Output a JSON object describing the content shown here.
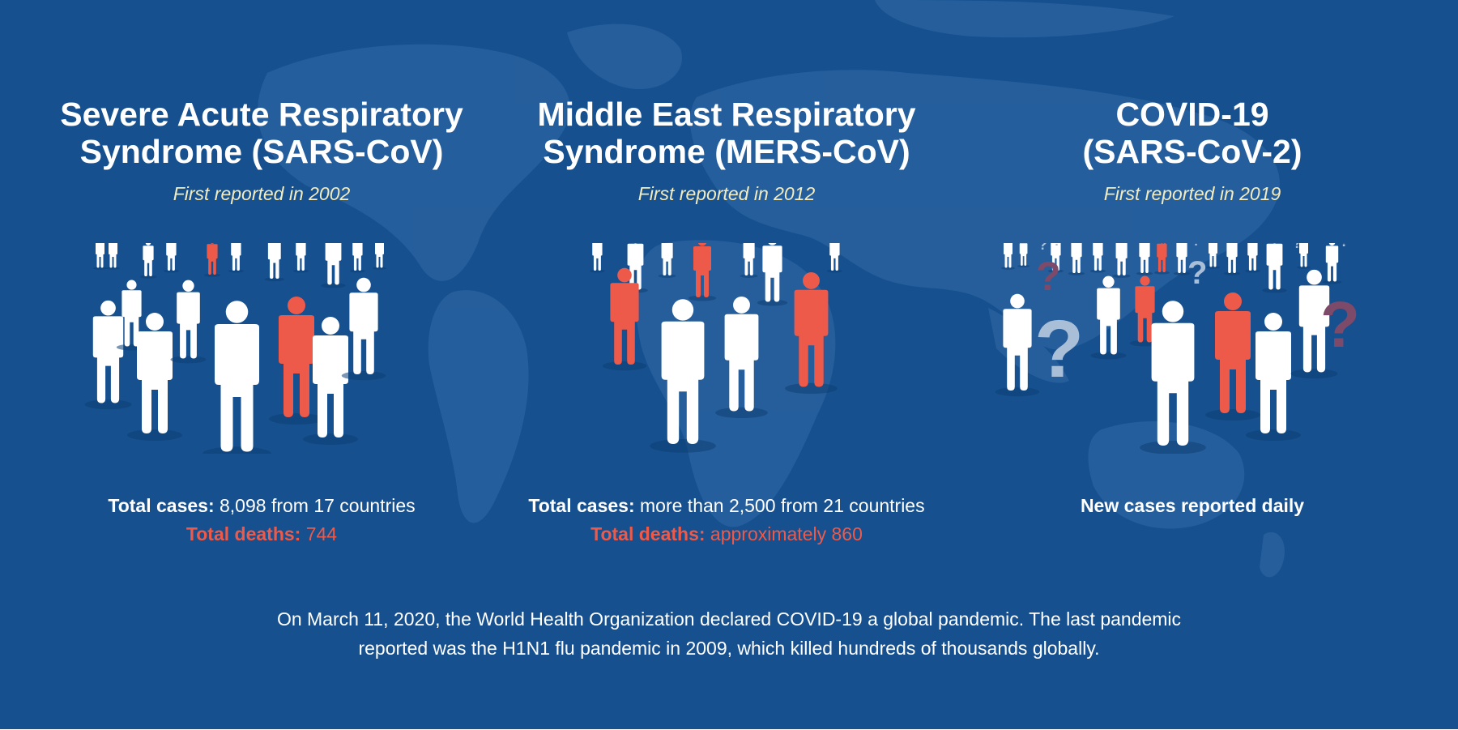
{
  "colors": {
    "background": "#16508f",
    "person_white": "#ffffff",
    "person_red": "#ee5a49",
    "subtitle": "#f3ecbe",
    "question_light": "#a9bfd8",
    "question_dark": "#7d4a6a"
  },
  "panels": [
    {
      "title_line1": "Severe Acute Respiratory",
      "title_line2": "Syndrome (SARS-CoV)",
      "subtitle": "First reported in 2002",
      "cases_label": "Total cases:",
      "cases_value": " 8,098 from 17 countries",
      "deaths_label": "Total deaths:",
      "deaths_value": " 744"
    },
    {
      "title_line1": "Middle East Respiratory",
      "title_line2": "Syndrome (MERS-CoV)",
      "subtitle": "First reported in 2012",
      "cases_label": "Total cases:",
      "cases_value": " more than 2,500 from 21 countries",
      "deaths_label": "Total deaths:",
      "deaths_value": " approximately 860"
    },
    {
      "title_line1": "COVID-19",
      "title_line2": "(SARS-CoV-2)",
      "subtitle": "First reported in 2019",
      "cases_label": "New cases reported daily",
      "cases_value": ""
    }
  ],
  "footnote_line1": "On March 11, 2020, the World Health Organization declared COVID-19 a global pandemic. The last pandemic",
  "footnote_line2": "reported was the H1N1 flu pandemic in 2009, which killed hundreds of thousands globally.",
  "icons": [
    "person-icon",
    "question-mark-icon",
    "world-map-icon"
  ]
}
